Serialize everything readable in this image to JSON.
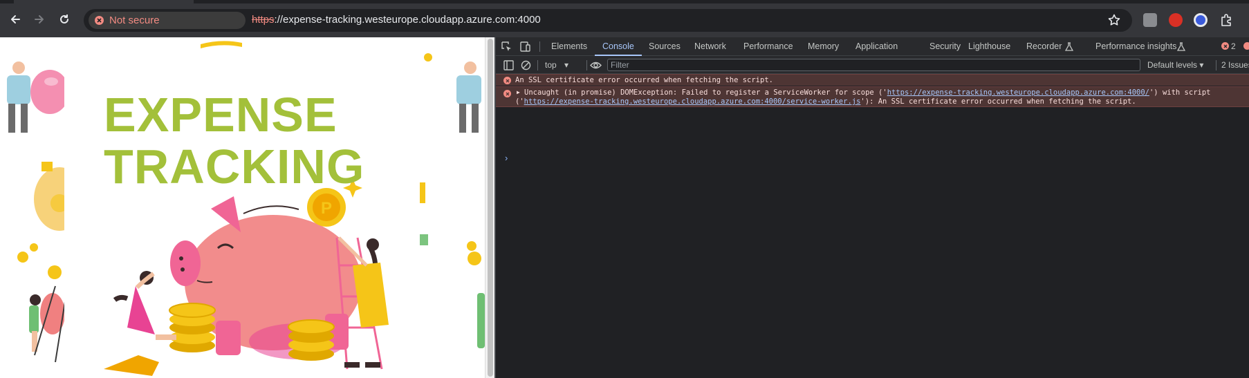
{
  "browser": {
    "security_chip": "Not secure",
    "url_scheme": "https",
    "url_rest": "://expense-tracking.westeurope.cloudapp.azure.com:4000"
  },
  "page": {
    "hero_line1": "EXPENSE",
    "hero_line2": "TRACKING",
    "colors": {
      "title": "#a3c03a",
      "pig": "#f08080",
      "coin": "#f5c518"
    }
  },
  "devtools": {
    "tabs": [
      "Elements",
      "Console",
      "Sources",
      "Network",
      "Performance",
      "Memory",
      "Application",
      "Security",
      "Lighthouse",
      "Recorder",
      "Performance insights"
    ],
    "active_tab": "Console",
    "error_count": "2",
    "filter_placeholder": "Filter",
    "context": "top",
    "levels": "Default levels",
    "issues": "2 Issues",
    "messages": {
      "msg1": "An SSL certificate error occurred when fetching the script.",
      "msg2_line1_prefix": "Uncaught (in promise) DOMException: Failed to register a ServiceWorker for scope ('",
      "msg2_link1": "https://expense-tracking.westeurope.cloudapp.azure.com:4000/",
      "msg2_line1_suffix": "') with script",
      "msg2_line2_prefix": "('",
      "msg2_link2": "https://expense-tracking.westeurope.cloudapp.azure.com:4000/service-worker.js",
      "msg2_line2_suffix": "'): An SSL certificate error occurred when fetching the script."
    }
  }
}
